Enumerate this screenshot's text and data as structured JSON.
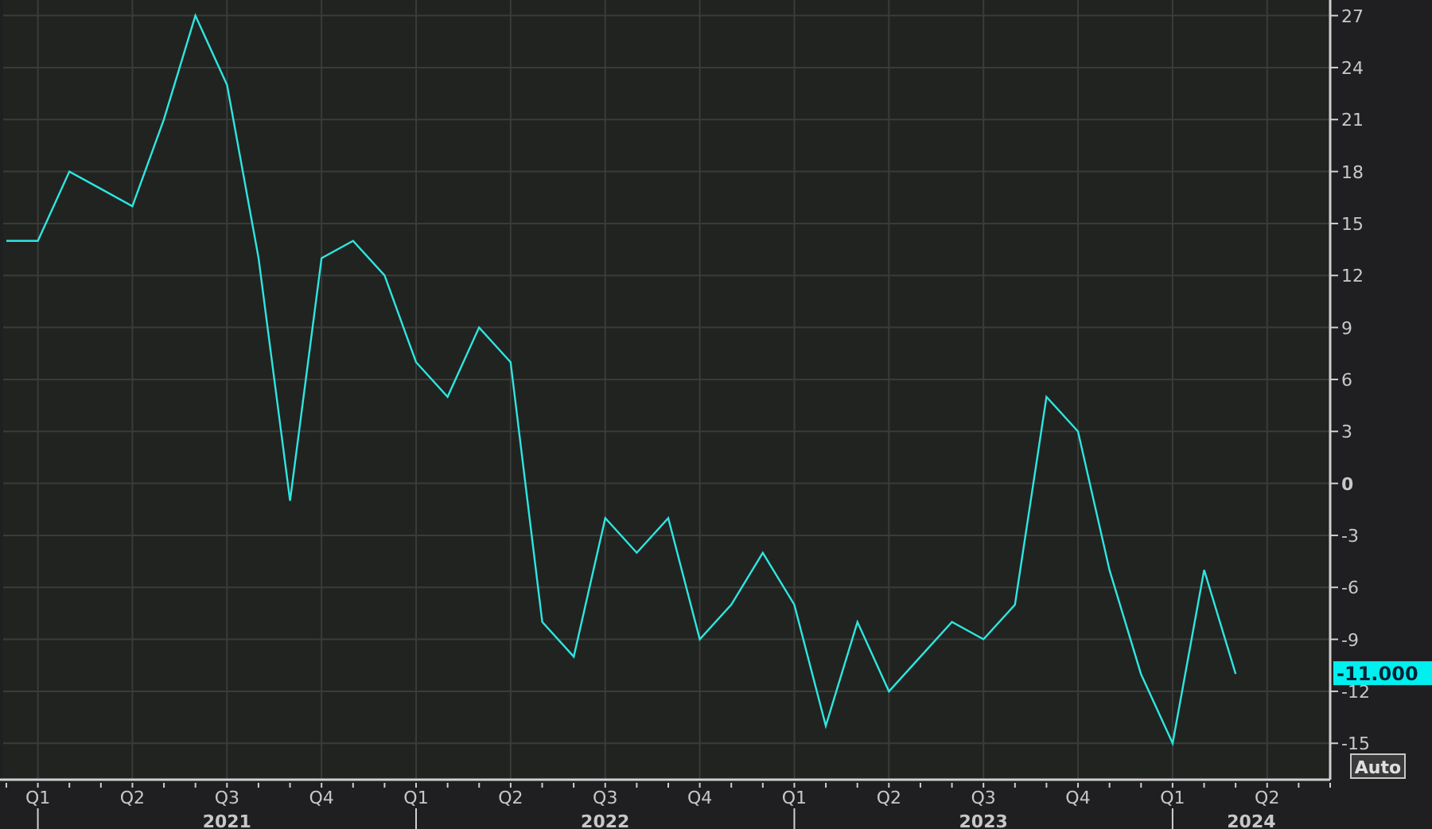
{
  "chart": {
    "chart_data": {
      "type": "line",
      "categories": [
        null,
        "Q1",
        null,
        null,
        "Q2",
        null,
        null,
        "Q3",
        null,
        null,
        "Q4",
        null,
        null,
        "Q1",
        null,
        null,
        "Q2",
        null,
        null,
        "Q3",
        null,
        null,
        "Q4",
        null,
        null,
        "Q1",
        null,
        null,
        "Q2",
        null,
        null,
        "Q3",
        null,
        null,
        "Q4",
        null,
        null,
        "Q1",
        null,
        null,
        "Q2"
      ],
      "series": [
        {
          "color": "#2ee6e0",
          "values": [
            14,
            14,
            18,
            17,
            16,
            21,
            27,
            23,
            13,
            -1,
            13,
            14,
            12,
            7,
            5,
            9,
            7,
            -8,
            -10,
            -2,
            -4,
            -2,
            -9,
            -7,
            -4,
            -7,
            -14,
            -8,
            -12,
            -10,
            -8,
            -9,
            -7,
            5,
            3,
            -5,
            -11,
            -15,
            -5,
            -11,
            null
          ]
        }
      ],
      "grid": true,
      "ylim": [
        -17.1,
        27.9
      ],
      "yticks": [
        27,
        24,
        21,
        18,
        15,
        12,
        9,
        6,
        3,
        0,
        -3,
        -6,
        -9,
        -12,
        -15
      ]
    },
    "year_labels": [
      "2021",
      "2022",
      "2023",
      "2024"
    ],
    "last_value_label": "-11.000",
    "auto_button": "Auto"
  }
}
